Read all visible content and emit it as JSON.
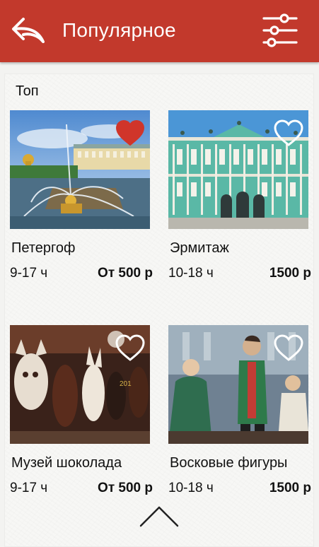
{
  "header": {
    "title": "Популярное",
    "back_icon": "back-arrow-icon",
    "filter_icon": "sliders-icon",
    "bar_color": "#c2392c"
  },
  "section": {
    "title": "Топ"
  },
  "cards": [
    {
      "name": "Петергоф",
      "hours": "9-17 ч",
      "price": "От 500 р",
      "favorite": true,
      "image": "peterhof-fountains"
    },
    {
      "name": "Эрмитаж",
      "hours": "10-18 ч",
      "price": "1500 р",
      "favorite": false,
      "image": "winter-palace"
    },
    {
      "name": "Музей шоколада",
      "hours": "9-17 ч",
      "price": "От 500 р",
      "favorite": false,
      "image": "chocolate-figures"
    },
    {
      "name": "Восковые фигуры",
      "hours": "10-18 ч",
      "price": "1500 р",
      "favorite": false,
      "image": "wax-figures"
    }
  ],
  "colors": {
    "favorite_active": "#d0352a",
    "favorite_outline": "#ffffff"
  },
  "scroll_icon": "chevron-up-icon"
}
